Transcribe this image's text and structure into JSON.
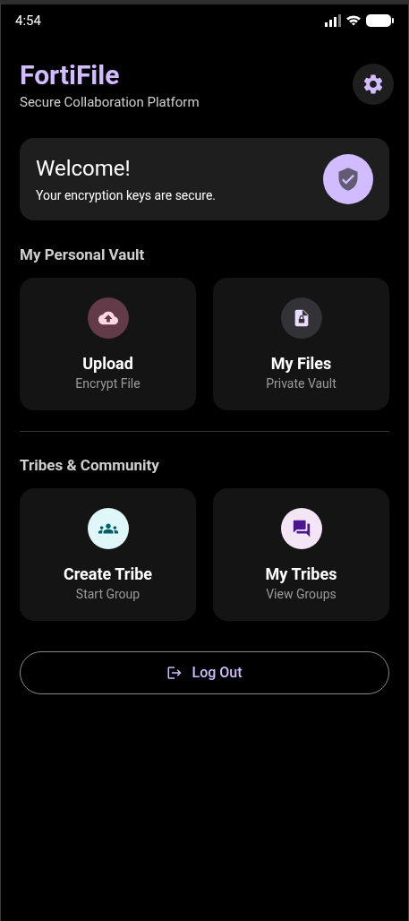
{
  "status_bar": {
    "time": "4:54"
  },
  "header": {
    "title": "FortiFile",
    "subtitle": "Secure Collaboration Platform"
  },
  "welcome": {
    "title": "Welcome!",
    "message": "Your encryption keys are secure."
  },
  "sections": [
    {
      "title": "My Personal Vault",
      "tiles": [
        {
          "kind": "upload",
          "title": "Upload",
          "subtitle": "Encrypt File"
        },
        {
          "kind": "files",
          "title": "My Files",
          "subtitle": "Private Vault"
        }
      ]
    },
    {
      "title": "Tribes & Community",
      "tiles": [
        {
          "kind": "group",
          "title": "Create Tribe",
          "subtitle": "Start Group"
        },
        {
          "kind": "chat",
          "title": "My Tribes",
          "subtitle": "View Groups"
        }
      ]
    }
  ],
  "logout": {
    "label": "Log Out"
  }
}
